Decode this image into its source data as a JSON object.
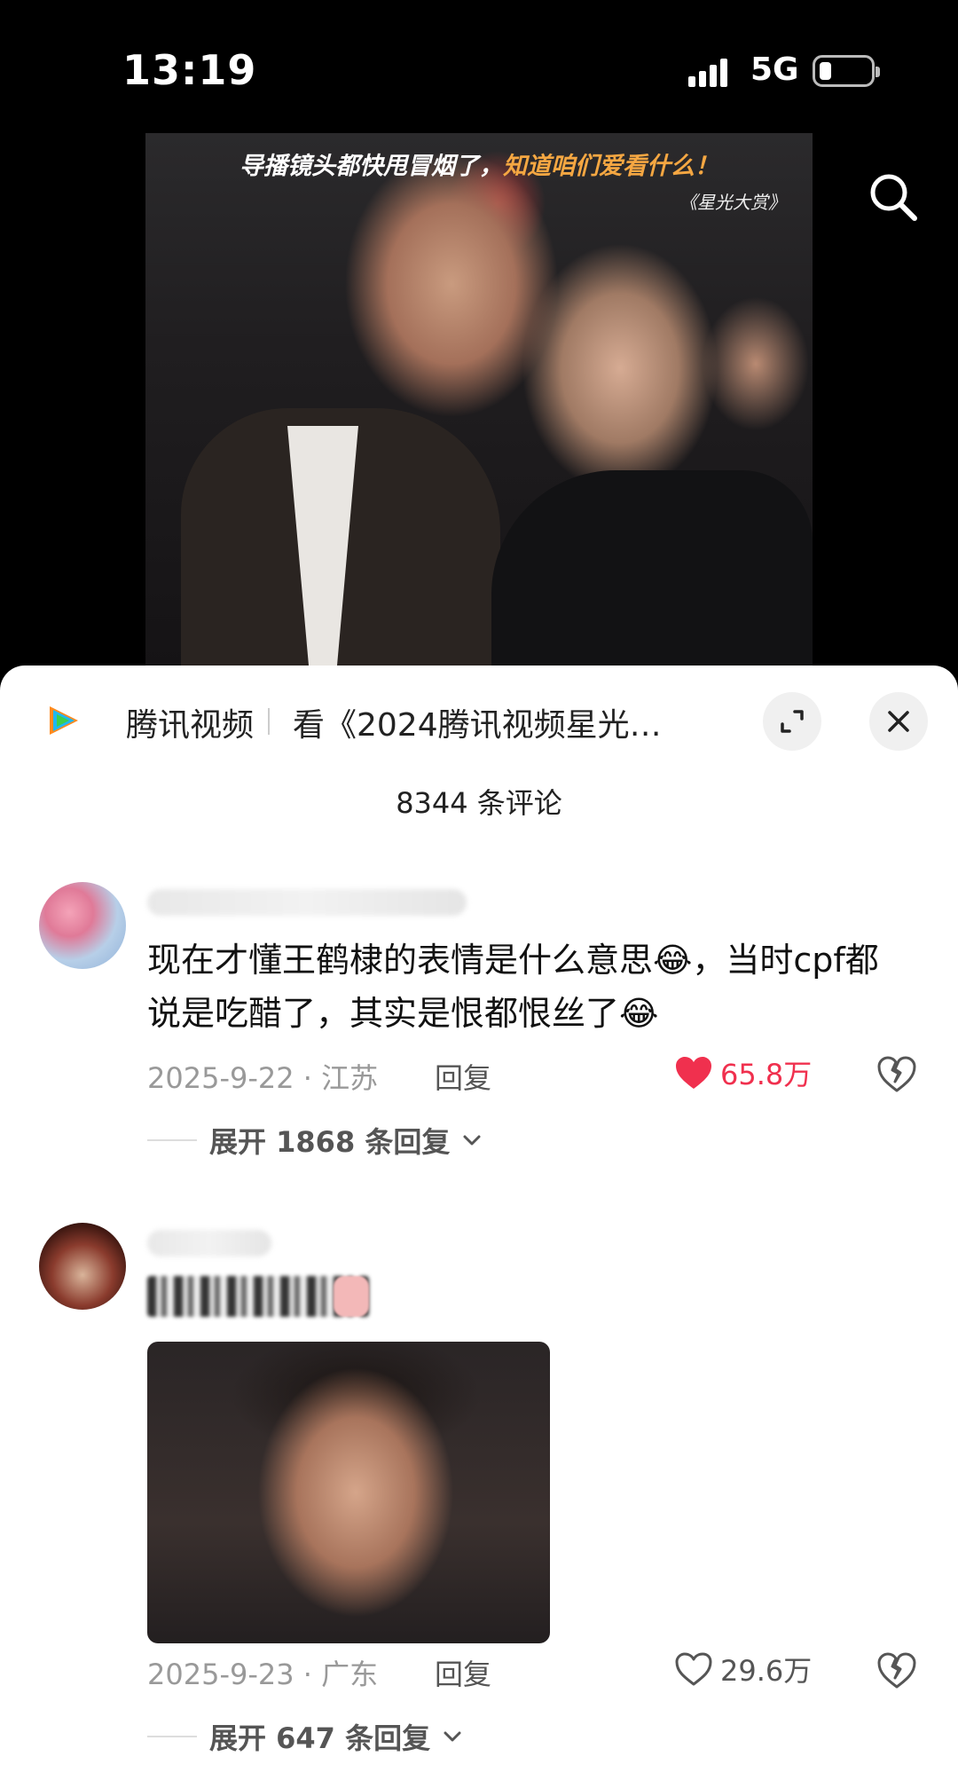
{
  "status_bar": {
    "time": "13:19",
    "network": "5G"
  },
  "video": {
    "banner_white": "导播镜头都快甩冒烟了，",
    "banner_highlight": "知道咱们爱看什么！",
    "banner_sub": "《星光大赏》"
  },
  "panel": {
    "app_name": "腾讯视频",
    "title": "看《2024腾讯视频星光…",
    "comment_count": "8344 条评论"
  },
  "comments": [
    {
      "text": "现在才懂王鹤棣的表情是什么意思😂，当时cpf都说是吃醋了，其实是恨都恨丝了😂",
      "date_location": "2025-9-22 · 江苏",
      "reply_label": "回复",
      "likes": "65.8万",
      "liked": true,
      "expand_label": "展开 1868 条回复"
    },
    {
      "date_location": "2025-9-23 · 广东",
      "reply_label": "回复",
      "likes": "29.6万",
      "liked": false,
      "expand_label": "展开 647 条回复"
    }
  ],
  "colors": {
    "like_red": "#f0304e",
    "accent_orange": "#f5a742"
  }
}
